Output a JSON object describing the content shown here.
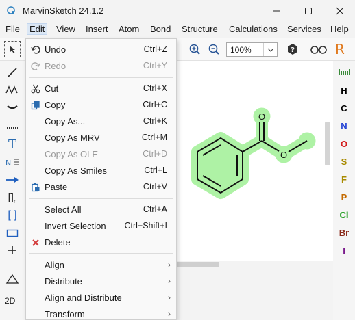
{
  "window": {
    "title": "MarvinSketch 24.1.2",
    "minimize_icon": "minimize-icon",
    "maximize_icon": "maximize-icon",
    "close_icon": "close-icon"
  },
  "menubar": [
    "File",
    "Edit",
    "View",
    "Insert",
    "Atom",
    "Bond",
    "Structure",
    "Calculations",
    "Services",
    "Help"
  ],
  "toolbar": {
    "zoom_value": "100%",
    "icons": [
      "selection-icon",
      "zoom-in-icon",
      "zoom-out-icon",
      "help-icon",
      "glasses-icon",
      "r-group-icon"
    ]
  },
  "edit_menu": [
    {
      "label": "Undo",
      "shortcut": "Ctrl+Z",
      "icon": "undo-icon",
      "enabled": true
    },
    {
      "label": "Redo",
      "shortcut": "Ctrl+Y",
      "icon": "redo-icon",
      "enabled": false
    },
    {
      "label": "Cut",
      "shortcut": "Ctrl+X",
      "icon": "cut-icon",
      "enabled": true
    },
    {
      "label": "Copy",
      "shortcut": "Ctrl+C",
      "icon": "copy-icon",
      "enabled": true
    },
    {
      "label": "Copy As...",
      "shortcut": "Ctrl+K",
      "icon": "",
      "enabled": true
    },
    {
      "label": "Copy As MRV",
      "shortcut": "Ctrl+M",
      "icon": "",
      "enabled": true
    },
    {
      "label": "Copy As OLE",
      "shortcut": "Ctrl+D",
      "icon": "",
      "enabled": false
    },
    {
      "label": "Copy As Smiles",
      "shortcut": "Ctrl+L",
      "icon": "",
      "enabled": false
    },
    {
      "label": "Paste",
      "shortcut": "Ctrl+V",
      "icon": "paste-icon",
      "enabled": true
    },
    {
      "label": "Select All",
      "shortcut": "Ctrl+A",
      "icon": "",
      "enabled": true
    },
    {
      "label": "Invert Selection",
      "shortcut": "Ctrl+Shift+I",
      "icon": "",
      "enabled": true
    },
    {
      "label": "Delete",
      "shortcut": "",
      "icon": "delete-icon",
      "enabled": true
    },
    {
      "label": "Align",
      "shortcut": "",
      "icon": "",
      "enabled": true,
      "submenu": true
    },
    {
      "label": "Distribute",
      "shortcut": "",
      "icon": "",
      "enabled": true,
      "submenu": true
    },
    {
      "label": "Align and Distribute",
      "shortcut": "",
      "icon": "",
      "enabled": true,
      "submenu": true
    },
    {
      "label": "Transform",
      "shortcut": "",
      "icon": "",
      "enabled": true,
      "submenu": true
    }
  ],
  "elements": [
    "H",
    "C",
    "N",
    "O",
    "S",
    "F",
    "P",
    "Cl",
    "Br",
    "I"
  ],
  "element_colors": {
    "H": "#000000",
    "C": "#000000",
    "N": "#1f3fd4",
    "O": "#d41f1f",
    "S": "#a88a00",
    "F": "#a88a00",
    "P": "#c46a00",
    "Cl": "#1a9a1a",
    "Br": "#8b2a1a",
    "I": "#7a1a8b"
  },
  "molecule": {
    "oxygen_labels": [
      "O",
      "O"
    ],
    "highlight_color": "#aef2a5"
  },
  "left_tools": {
    "bracket_label": "[]",
    "bracket_sub": "n",
    "dimension_label": "2D"
  }
}
